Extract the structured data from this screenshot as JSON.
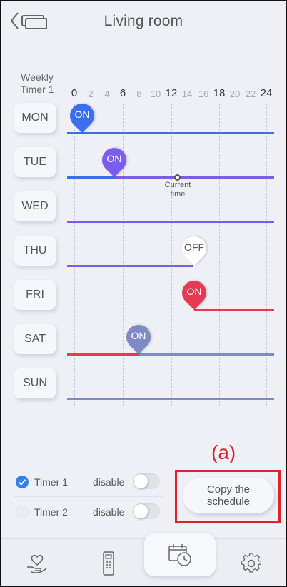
{
  "header": {
    "title": "Living room",
    "back_icon": "back-chevron-icon"
  },
  "timeline": {
    "timer_label": "Weekly\nTimer 1",
    "hours": [
      "0",
      "2",
      "4",
      "6",
      "8",
      "10",
      "12",
      "14",
      "16",
      "18",
      "20",
      "22",
      "24"
    ],
    "major_hours": [
      "0",
      "6",
      "12",
      "18",
      "24"
    ],
    "current_time_label": "Current\ntime",
    "days": [
      {
        "label": "MON",
        "event": "ON"
      },
      {
        "label": "TUE",
        "event": "ON"
      },
      {
        "label": "WED",
        "event": ""
      },
      {
        "label": "THU",
        "event": "OFF"
      },
      {
        "label": "FRI",
        "event": "ON"
      },
      {
        "label": "SAT",
        "event": "ON"
      },
      {
        "label": "SUN",
        "event": ""
      }
    ]
  },
  "annotation": {
    "label": "(a)"
  },
  "copy_button": {
    "label": "Copy the\nschedule"
  },
  "timers": [
    {
      "name": "Timer 1",
      "checked": true,
      "toggle_label": "disable"
    },
    {
      "name": "Timer 2",
      "checked": false,
      "toggle_label": "disable"
    }
  ],
  "nav": [
    {
      "icon": "heart-hand-icon"
    },
    {
      "icon": "remote-icon"
    },
    {
      "icon": "calendar-clock-icon",
      "active": true
    },
    {
      "icon": "gear-icon"
    }
  ],
  "colors": {
    "blue": "#3d6df0",
    "violet": "#7a5cf0",
    "slate": "#7f8ac4",
    "red": "#e43a52",
    "annotation_red": "#e0202a",
    "check_blue": "#2f80ed"
  }
}
